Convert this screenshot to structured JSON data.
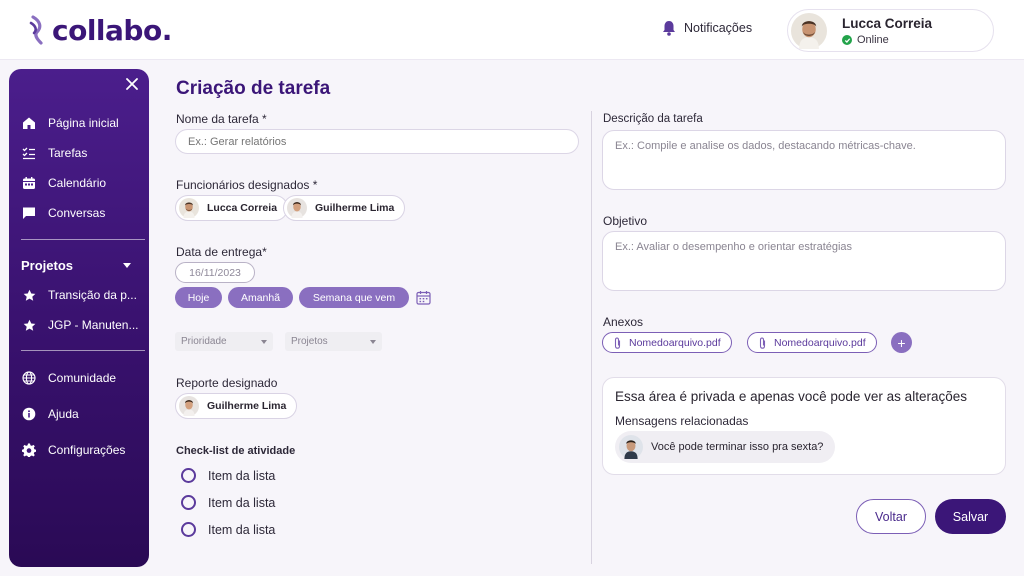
{
  "brand": {
    "name": "collabo."
  },
  "header": {
    "notifications_label": "Notificações",
    "user": {
      "name": "Lucca Correia",
      "status": "Online"
    }
  },
  "sidebar": {
    "items": [
      {
        "label": "Página inicial",
        "icon": "home-icon"
      },
      {
        "label": "Tarefas",
        "icon": "checklist-icon"
      },
      {
        "label": "Calendário",
        "icon": "calendar-icon"
      },
      {
        "label": "Conversas",
        "icon": "chat-icon"
      }
    ],
    "projects_section": "Projetos",
    "projects": [
      {
        "label": "Transição da p...",
        "icon": "star-icon"
      },
      {
        "label": "JGP - Manuten...",
        "icon": "star-icon"
      }
    ],
    "footer_items": [
      {
        "label": "Comunidade",
        "icon": "globe-icon"
      },
      {
        "label": "Ajuda",
        "icon": "info-icon"
      },
      {
        "label": "Configurações",
        "icon": "gear-icon"
      }
    ]
  },
  "form": {
    "title": "Criação de tarefa",
    "task_name": {
      "label": "Nome da tarefa *",
      "placeholder": "Ex.: Gerar relatórios"
    },
    "assigned": {
      "label": "Funcionários designados *",
      "users": [
        "Lucca Correia",
        "Guilherme Lima"
      ]
    },
    "due_date": {
      "label": "Data de entrega*",
      "value": "16/11/2023",
      "quick_options": [
        "Hoje",
        "Amanhã",
        "Semana que vem"
      ]
    },
    "priority": {
      "placeholder": "Prioridade"
    },
    "projects": {
      "placeholder": "Projetos"
    },
    "reporter": {
      "label": "Reporte designado",
      "user": "Guilherme Lima"
    },
    "checklist": {
      "label": "Check-list de atividade",
      "items": [
        "Item da lista",
        "Item da lista",
        "Item da lista"
      ]
    },
    "description": {
      "label": "Descrição da tarefa",
      "placeholder": "Ex.: Compile e analise os dados, destacando métricas-chave."
    },
    "objective": {
      "label": "Objetivo",
      "placeholder": "Ex.: Avaliar o desempenho e orientar estratégias"
    },
    "attachments": {
      "label": "Anexos",
      "files": [
        "Nomedoarquivo.pdf",
        "Nomedoarquivo.pdf"
      ],
      "add": "+"
    },
    "private": {
      "title": "Essa área é privada e apenas você pode ver as alterações",
      "subtitle": "Mensagens relacionadas",
      "message": "Você pode terminar isso pra sexta?"
    },
    "actions": {
      "back": "Voltar",
      "save": "Salvar"
    }
  },
  "colors": {
    "brand": "#3b1678",
    "accent": "#8a6fc0",
    "online": "#22a34a"
  }
}
